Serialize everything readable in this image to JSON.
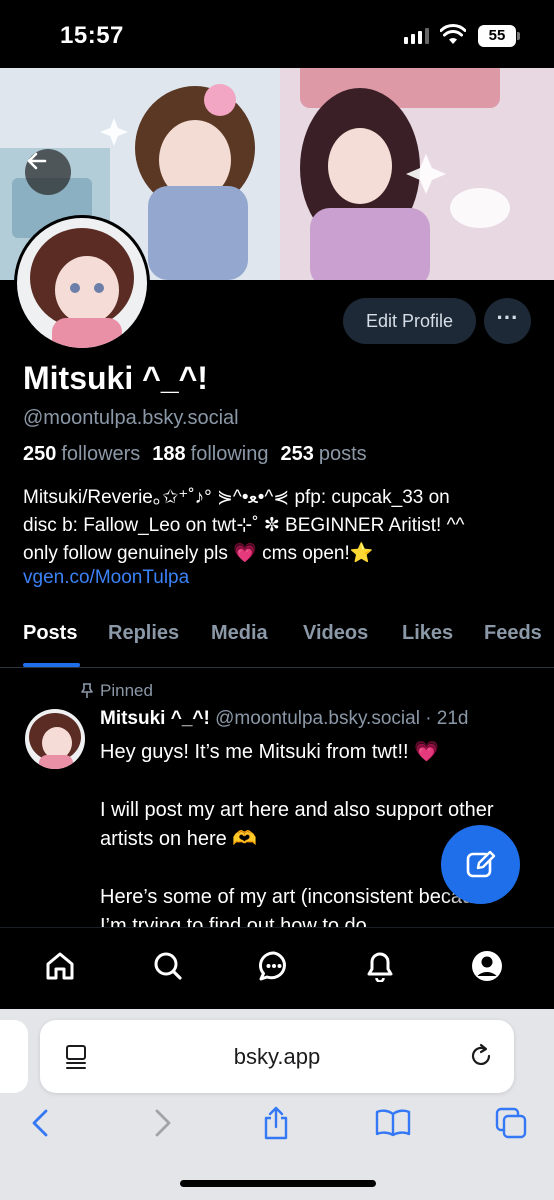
{
  "status_bar": {
    "time": "15:57",
    "battery": "55"
  },
  "profile": {
    "display_name": "Mitsuki ^_^!",
    "handle": "@moontulpa.bsky.social",
    "edit_label": "Edit Profile",
    "more_label": "···",
    "stats": {
      "followers_count": "250",
      "followers_label": "followers",
      "following_count": "188",
      "following_label": "following",
      "posts_count": "253",
      "posts_label": "posts"
    },
    "bio_lines": [
      "Mitsuki/Reverie｡✩⁺˚♪° ⋟^•ﻌ•^⋞ pfp: cupcak_33 on",
      "disc b: Fallow_Leo on twt⊹˚ ✼ BEGINNER Aritist! ^^",
      "only follow genuinely pls 💗 cms open!⭐"
    ],
    "bio_link": "vgen.co/MoonTulpa"
  },
  "tabs": [
    "Posts",
    "Replies",
    "Media",
    "Videos",
    "Likes",
    "Feeds"
  ],
  "post": {
    "pinned_label": "Pinned",
    "author": "Mitsuki ^_^!",
    "meta": "@moontulpa.bsky.social · 21d",
    "paragraphs": [
      "Hey guys! It’s me Mitsuki from twt!! 💗",
      "I will post my art here and also support other artists on here 🫶",
      "Here’s some of my art (inconsistent because I’m trying to find out how to do"
    ]
  },
  "browser": {
    "url": "bsky.app"
  },
  "colors": {
    "accent": "#1f6feb",
    "link": "#3b82f6",
    "muted": "#8b98a7",
    "button_bg": "#1e2937"
  },
  "icons": {
    "banner": "back-arrow-icon",
    "nav": [
      "home-icon",
      "search-icon",
      "chat-icon",
      "bell-icon",
      "profile-icon"
    ],
    "fab": "compose-icon",
    "safari_toolbar": [
      "back-chevron-icon",
      "forward-chevron-icon",
      "share-icon",
      "bookmarks-icon",
      "tabs-icon"
    ]
  }
}
